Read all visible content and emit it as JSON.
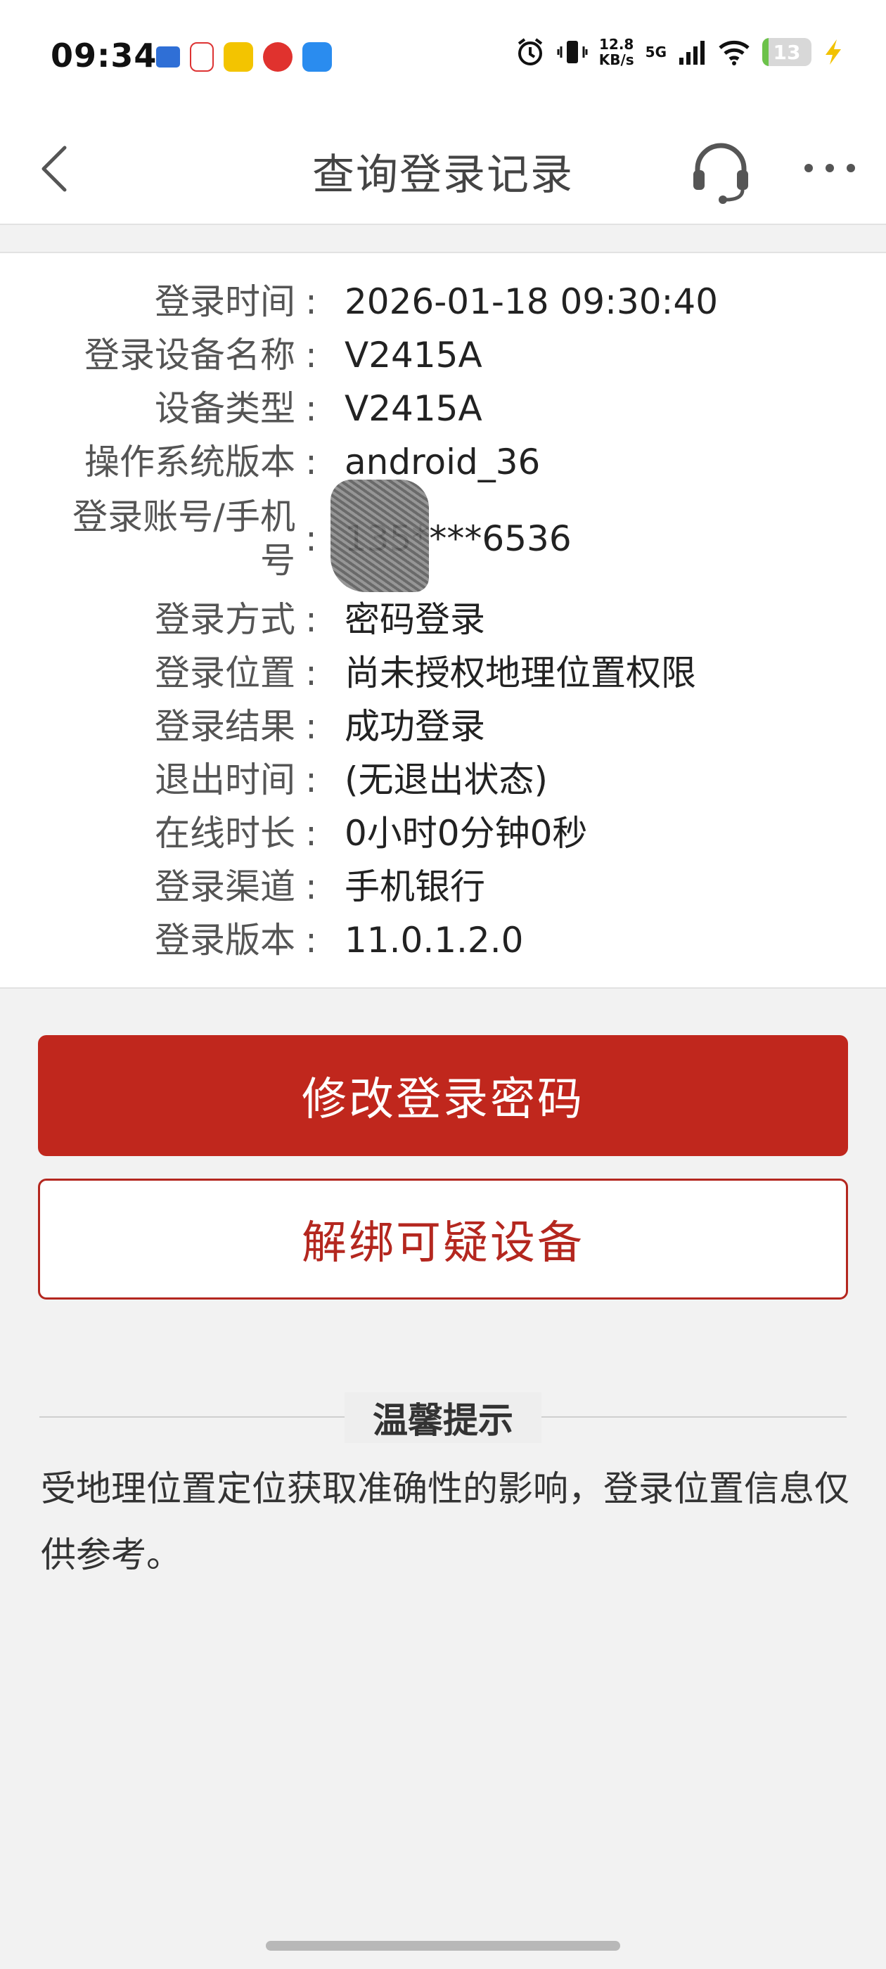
{
  "status_bar": {
    "time": "09:34",
    "net_speed_value": "12.8",
    "net_speed_unit": "KB/s",
    "network": "5G",
    "battery_level": "13",
    "icons": [
      "alarm-icon",
      "vibrate-icon",
      "signal-icon",
      "wifi-icon",
      "battery-icon",
      "charging-icon"
    ]
  },
  "nav": {
    "title": "查询登录记录",
    "back_icon": "chevron-left-icon",
    "support_icon": "headset-icon",
    "more_icon": "more-icon"
  },
  "login_info": {
    "rows": [
      {
        "label": "登录时间",
        "value": "2026-01-18   09:30:40"
      },
      {
        "label": "登录设备名称",
        "value": "V2415A"
      },
      {
        "label": "设备类型",
        "value": "V2415A"
      },
      {
        "label": "操作系统版本",
        "value": "android_36"
      },
      {
        "label": "登录账号/手机号",
        "value": "135****6536"
      },
      {
        "label": "登录方式",
        "value": "密码登录"
      },
      {
        "label": "登录位置",
        "value": "尚未授权地理位置权限"
      },
      {
        "label": "登录结果",
        "value": "成功登录"
      },
      {
        "label": "退出时间",
        "value": "(无退出状态)"
      },
      {
        "label": "在线时长",
        "value": "0小时0分钟0秒"
      },
      {
        "label": "登录渠道",
        "value": "手机银行"
      },
      {
        "label": "登录版本",
        "value": "11.0.1.2.0"
      }
    ],
    "colon": ":"
  },
  "actions": {
    "change_password": "修改登录密码",
    "unbind_device": "解绑可疑设备"
  },
  "tip": {
    "title": "温馨提示",
    "body": "受地理位置定位获取准确性的影响，登录位置信息仅供参考。"
  },
  "colors": {
    "primary_red": "#c0271d",
    "background": "#f2f2f2"
  }
}
